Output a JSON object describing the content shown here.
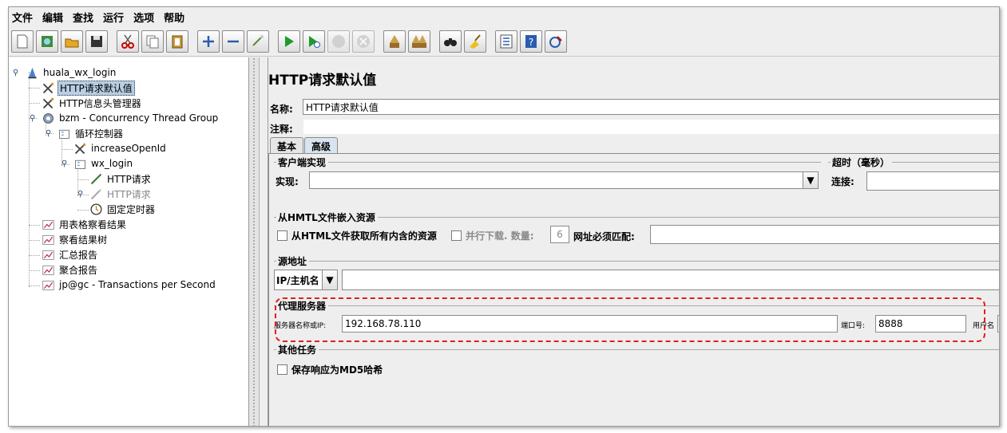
{
  "menu": [
    "文件",
    "编辑",
    "查找",
    "运行",
    "选项",
    "帮助"
  ],
  "toolbar_icons": [
    "new-icon",
    "open-templates-icon",
    "open-icon",
    "save-icon",
    "cut-icon",
    "copy-icon",
    "paste-icon",
    "expand-icon",
    "collapse-icon",
    "toggle-icon",
    "start-icon",
    "start-no-pauses-icon",
    "stop-icon",
    "shutdown-icon",
    "clear-icon",
    "clear-all-icon",
    "search-icon",
    "reset-search-icon",
    "function-helper-icon",
    "help-icon",
    "remote-icon"
  ],
  "tree": {
    "root": "huala_wx_login",
    "http_defaults": "HTTP请求默认值",
    "header_manager": "HTTP信息头管理器",
    "thread_group": "bzm - Concurrency Thread Group",
    "loop_controller": "循环控制器",
    "increase_openid": "increaseOpenId",
    "wx_login": "wx_login",
    "http_request_1": "HTTP请求",
    "http_request_2": "HTTP请求",
    "timer": "固定定时器",
    "table_results": "用表格察看结果",
    "results_tree": "察看结果树",
    "summary_report": "汇总报告",
    "aggregate_report": "聚合报告",
    "tps_listener": "jp@gc - Transactions per Second"
  },
  "panel": {
    "title": "HTTP请求默认值",
    "name_label": "名称:",
    "name_value": "HTTP请求默认值",
    "comment_label": "注释:",
    "tabs": [
      "基本",
      "高级"
    ],
    "client_impl": {
      "title": "客户端实现",
      "impl_label": "实现:",
      "impl_value": ""
    },
    "timeout": {
      "title": "超时（毫秒）",
      "connect_label": "连接:"
    },
    "embedded": {
      "title": "从HMTL文件嵌入资源",
      "retrieve_all": "从HTML文件获取所有内含的资源",
      "parallel": "并行下载. 数量:",
      "parallel_count": "6",
      "url_match": "网址必须匹配:"
    },
    "source": {
      "title": "源地址",
      "type_value": "IP/主机名"
    },
    "proxy": {
      "title": "代理服务器",
      "server_label": "服务器名称或IP:",
      "server_value": "192.168.78.110",
      "port_label": "端口号:",
      "port_value": "8888",
      "user_label": "用户名"
    },
    "other": {
      "title": "其他任务",
      "md5": "保存响应为MD5哈希"
    }
  },
  "colors": {
    "highlight": "#e0201a",
    "selection": "#b8cfe5"
  }
}
